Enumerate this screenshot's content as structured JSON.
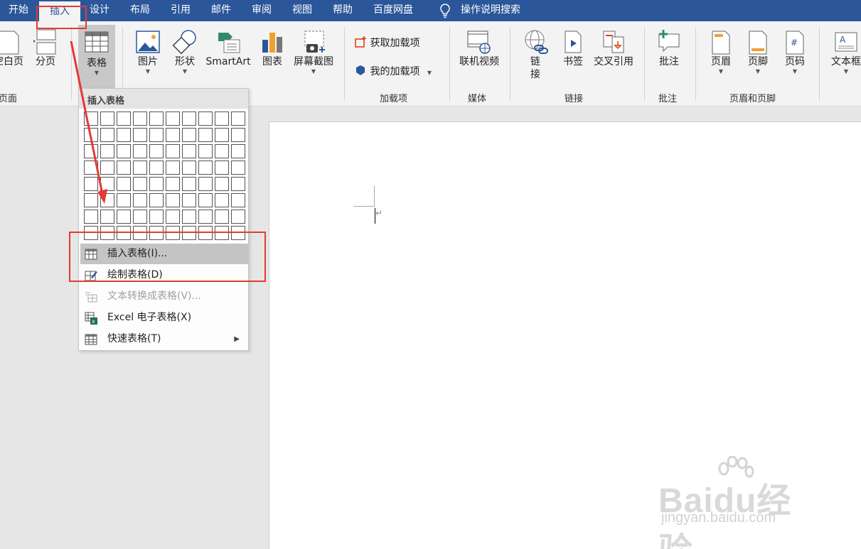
{
  "tabs": [
    {
      "label": "开始"
    },
    {
      "label": "插入"
    },
    {
      "label": "设计"
    },
    {
      "label": "布局"
    },
    {
      "label": "引用"
    },
    {
      "label": "邮件"
    },
    {
      "label": "审阅"
    },
    {
      "label": "视图"
    },
    {
      "label": "帮助"
    },
    {
      "label": "百度网盘"
    }
  ],
  "tell_me": "操作说明搜索",
  "ribbon": {
    "pages": {
      "blank": "空白页",
      "break": "分页",
      "group": "页面"
    },
    "table": {
      "label": "表格"
    },
    "illustrations": {
      "picture": "图片",
      "shapes": "形状",
      "smartart": "SmartArt",
      "chart": "图表",
      "screenshot": "屏幕截图"
    },
    "addins": {
      "get": "获取加载项",
      "mine": "我的加载项",
      "group": "加载项"
    },
    "media": {
      "video": "联机视频",
      "group": "媒体"
    },
    "links": {
      "link_a": "链",
      "link_b": "接",
      "bookmark": "书签",
      "crossref": "交叉引用",
      "group": "链接"
    },
    "comments": {
      "comment": "批注",
      "group": "批注"
    },
    "header_footer": {
      "header": "页眉",
      "footer": "页脚",
      "page_number": "页码",
      "group": "页眉和页脚"
    },
    "text": {
      "textbox": "文本框"
    }
  },
  "dropdown": {
    "header": "插入表格",
    "grid_cols": 10,
    "grid_rows": 8,
    "items": [
      {
        "label": "插入表格(I)...",
        "icon": "table-icon",
        "enabled": true,
        "highlighted": true
      },
      {
        "label": "绘制表格(D)",
        "icon": "draw-table-icon",
        "enabled": true,
        "highlighted": false
      },
      {
        "label": "文本转换成表格(V)...",
        "icon": "text-to-table-icon",
        "enabled": false,
        "highlighted": false
      },
      {
        "label": "Excel 电子表格(X)",
        "icon": "excel-icon",
        "enabled": true,
        "highlighted": false
      },
      {
        "label": "快速表格(T)",
        "icon": "quick-table-icon",
        "enabled": true,
        "highlighted": false,
        "submenu": true
      }
    ]
  },
  "document": {
    "paragraph_mark": "↵"
  },
  "watermark": {
    "line1": "Baidu经验",
    "line2": "jingyan.baidu.com"
  },
  "colors": {
    "accent": "#2b579a",
    "annotation": "#e53935",
    "ribbon_bg": "#f3f3f3",
    "highlight": "#c4c4c4"
  }
}
